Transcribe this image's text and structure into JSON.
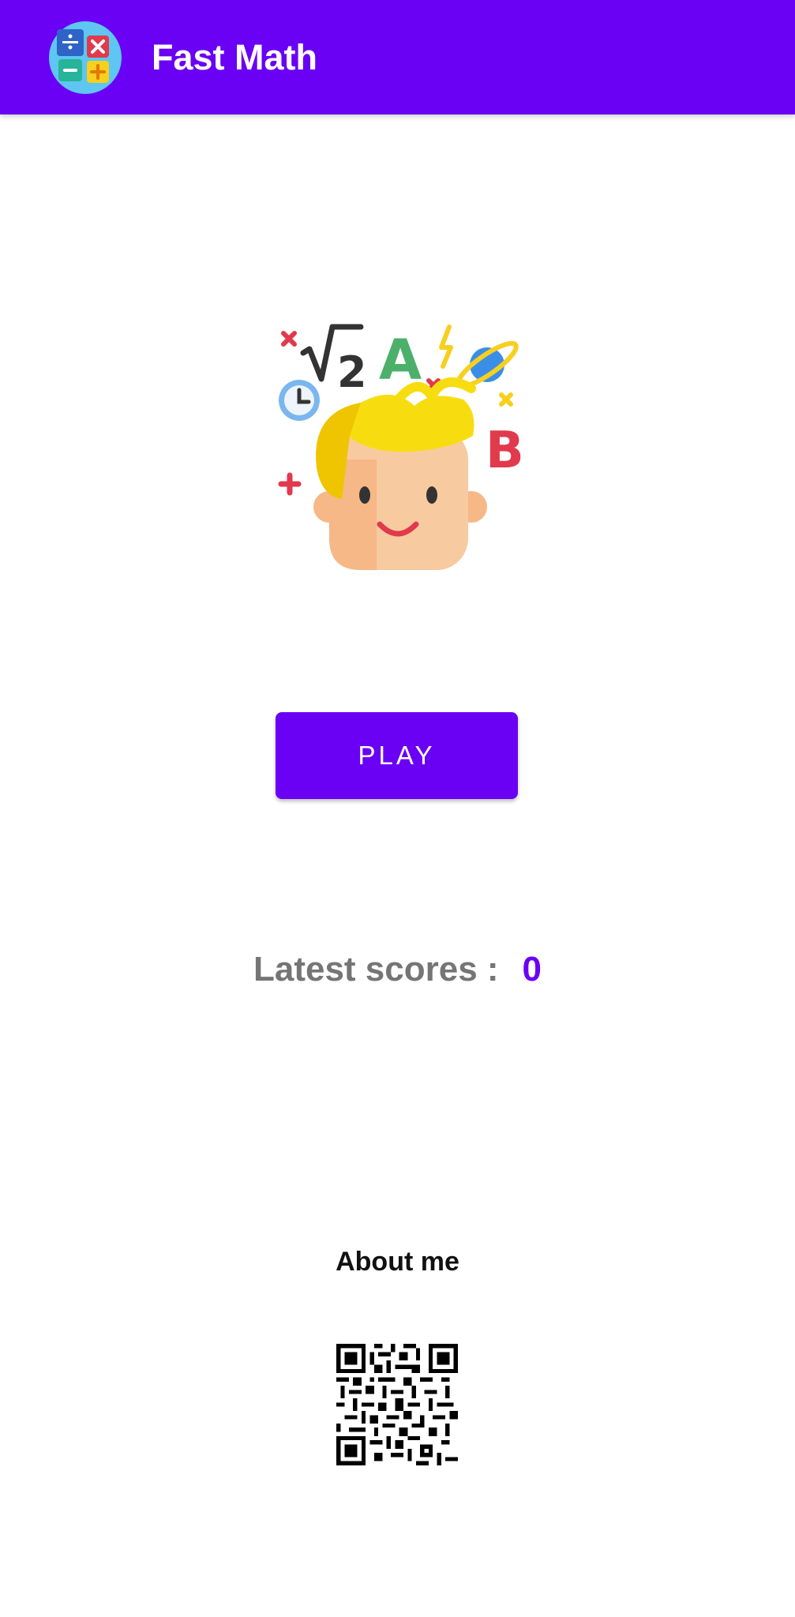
{
  "app_bar": {
    "title": "Fast Math",
    "logo_icon": "calculator-operators-icon",
    "color": "#6a00f4"
  },
  "hero": {
    "icon": "math-thinking-kid-illustration"
  },
  "play_button": {
    "label": "PLAY",
    "color": "#6a00f4"
  },
  "scores": {
    "label": "Latest scores :",
    "value": "0",
    "value_color": "#6a00f4"
  },
  "about": {
    "title": "About me",
    "qr_icon": "qr-code-icon"
  }
}
